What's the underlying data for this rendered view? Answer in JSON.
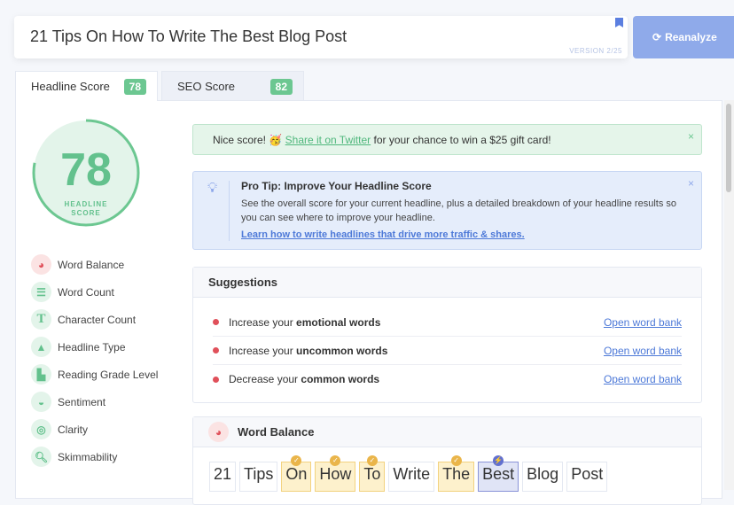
{
  "headline_input": {
    "value": "21 Tips On How To Write The Best Blog Post",
    "version": "VERSION 2/25"
  },
  "reanalyze_label": "Reanalyze",
  "tabs": [
    {
      "label": "Headline Score",
      "score": "78"
    },
    {
      "label": "SEO Score",
      "score": "82"
    }
  ],
  "score": {
    "value": "78",
    "label1": "HEADLINE",
    "label2": "SCORE",
    "fraction": 0.78
  },
  "nav": [
    "Word Balance",
    "Word Count",
    "Character Count",
    "Headline Type",
    "Reading Grade Level",
    "Sentiment",
    "Clarity",
    "Skimmability"
  ],
  "alert": {
    "pre": "Nice score! ",
    "link": "Share it on Twitter",
    "post": " for your chance to win a $25 gift card!",
    "close": "×"
  },
  "tip": {
    "title": "Pro Tip: Improve Your Headline Score",
    "body": "See the overall score for your current headline, plus a detailed breakdown of your headline results so you can see where to improve your headline.",
    "link": "Learn how to write headlines that drive more traffic & shares.",
    "close": "×"
  },
  "suggestions": {
    "title": "Suggestions",
    "items": [
      {
        "pre": "Increase your ",
        "bold": "emotional words",
        "link": "Open word bank"
      },
      {
        "pre": "Increase your ",
        "bold": "uncommon words",
        "link": "Open word bank"
      },
      {
        "pre": "Decrease your ",
        "bold": "common words",
        "link": "Open word bank"
      }
    ]
  },
  "word_balance": {
    "title": "Word Balance",
    "words": [
      {
        "w": "21",
        "t": ""
      },
      {
        "w": "Tips",
        "t": ""
      },
      {
        "w": "On",
        "t": "y"
      },
      {
        "w": "How",
        "t": "y"
      },
      {
        "w": "To",
        "t": "y"
      },
      {
        "w": "Write",
        "t": ""
      },
      {
        "w": "The",
        "t": "y"
      },
      {
        "w": "Best",
        "t": "b"
      },
      {
        "w": "Blog",
        "t": ""
      },
      {
        "w": "Post",
        "t": ""
      }
    ]
  },
  "colors": {
    "green": "#63c18d",
    "blue": "#8faaea",
    "red": "#e0505a"
  }
}
